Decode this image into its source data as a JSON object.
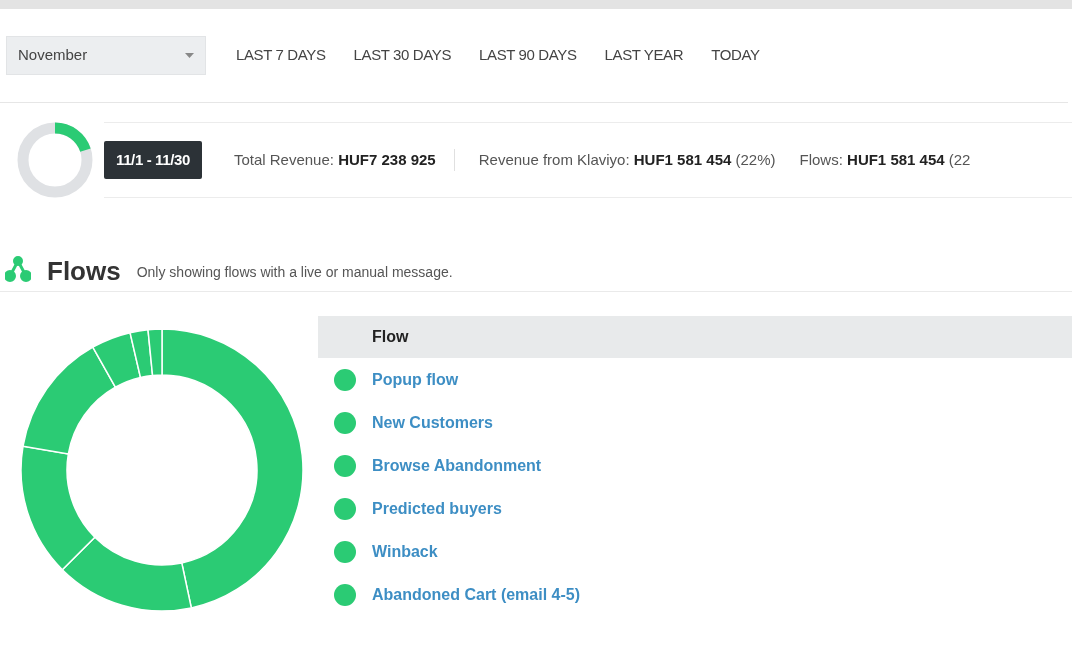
{
  "period_select": {
    "value": "November"
  },
  "range_links": [
    {
      "label": "LAST 7 DAYS"
    },
    {
      "label": "LAST 30 DAYS"
    },
    {
      "label": "LAST 90 DAYS"
    },
    {
      "label": "LAST YEAR"
    },
    {
      "label": "TODAY"
    }
  ],
  "summary": {
    "date_range": "11/1 - 11/30",
    "stats": [
      {
        "label": "Total Revenue:",
        "value": "HUF7 238 925"
      },
      {
        "label": "Revenue from Klaviyo:",
        "value": "HUF1 581 454",
        "share": "(22%)"
      },
      {
        "label": "Flows:",
        "value": "HUF1 581 454",
        "share": "(22"
      }
    ]
  },
  "flows": {
    "title": "Flows",
    "note": "Only showing flows with a live or manual message.",
    "table": {
      "columns": [
        "Flow"
      ],
      "rows": [
        {
          "name": "Popup flow"
        },
        {
          "name": "New Customers"
        },
        {
          "name": "Browse Abandonment"
        },
        {
          "name": "Predicted buyers"
        },
        {
          "name": "Winback"
        },
        {
          "name": "Abandoned Cart (email 4-5)"
        }
      ]
    }
  }
}
